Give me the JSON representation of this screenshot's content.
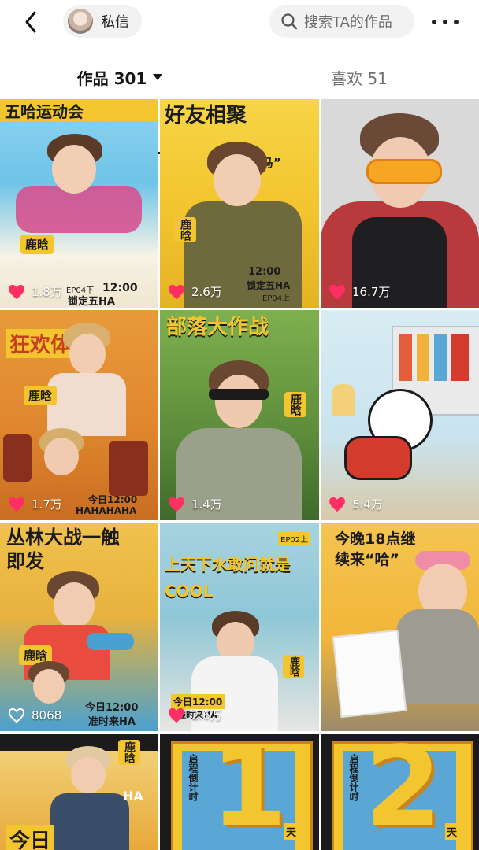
{
  "header": {
    "dm_label": "私信",
    "search_placeholder": "搜索TA的作品"
  },
  "tabs": {
    "works_label": "作品 301",
    "likes_label": "喜欢 51"
  },
  "videos": [
    {
      "likes": "1.8万",
      "caption": "五哈运动会",
      "theme": "#6fc4e8"
    },
    {
      "likes": "2.6万",
      "caption": "好友相聚",
      "theme": "#f3c52e"
    },
    {
      "likes": "16.7万",
      "caption": "",
      "theme": "#b83a3c"
    },
    {
      "likes": "1.7万",
      "caption": "狂欢体验",
      "theme": "#e0872e"
    },
    {
      "likes": "1.4万",
      "caption": "部落大作战",
      "theme": "#5c8c3a"
    },
    {
      "likes": "5.4万",
      "caption": "",
      "theme": "#c9e4ef"
    },
    {
      "likes": "8068",
      "caption": "丛林大战一触即发",
      "theme": "#e7b23d"
    },
    {
      "likes": "2.6万",
      "caption": "上天下水敢问就是COOL",
      "theme": "#8fc7d6"
    },
    {
      "likes": "",
      "caption": "今晚18点继续来“哈”",
      "theme": "#f1b63a"
    },
    {
      "likes": "",
      "caption": "今日",
      "theme": "#e8a93a"
    },
    {
      "likes": "",
      "caption": "1",
      "theme": "#5aa7d6"
    },
    {
      "likes": "",
      "caption": "2",
      "theme": "#5aa7d6"
    }
  ],
  "overlay_texts": {
    "v1_tag": "鹿晗",
    "v1_time": "12:00",
    "v1_sub": "锁定五HA",
    "v1_ep": "EP04下",
    "v2_tag": "鹿晗",
    "v2_time": "12:00",
    "v2_sub": "锁定五HA",
    "v2_ep": "EP04上",
    "v2_sub2": "抓“马”",
    "v4_tag": "鹿晗",
    "v4_time": "今日12:00",
    "v4_sub": "HAHAHAHA",
    "v5_tag": "鹿晗",
    "v7_tag": "鹿晗",
    "v7_time": "今日12:00",
    "v7_sub": "准时来HA",
    "v8_tag": "鹿晗",
    "v8_time": "今日12:00",
    "v8_sub": "准时来HA",
    "v8_ep": "EP02上",
    "v10_tag": "鹿晗",
    "v10_sub": "HA",
    "v11_side": "启程倒计时",
    "v11_unit": "天",
    "v12_side": "启程倒计时",
    "v12_unit": "天"
  }
}
